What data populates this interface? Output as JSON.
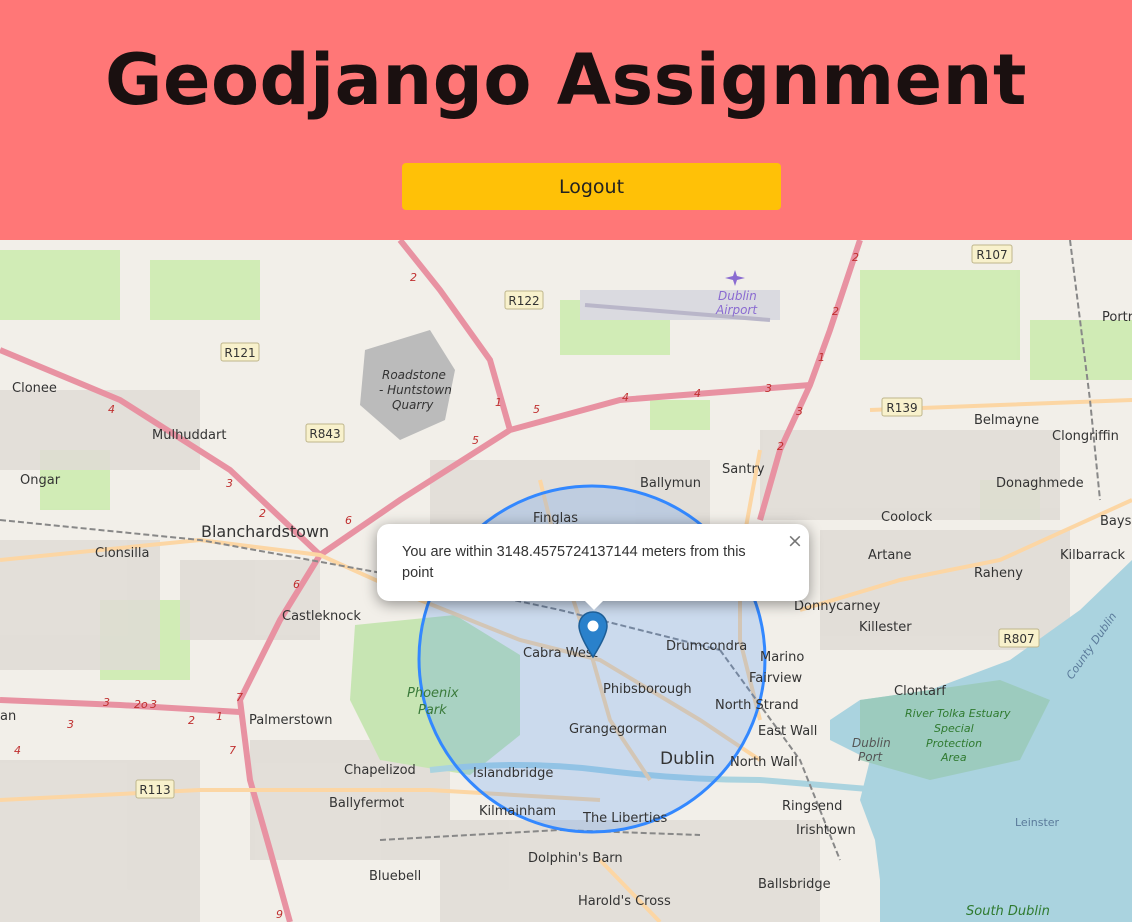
{
  "header": {
    "title": "Geodjango Assignment",
    "logout_label": "Logout",
    "bg_color": "#ff7777",
    "button_color": "#ffc107"
  },
  "map": {
    "circle_color": "#3388ff",
    "marker_icon": "map-marker-icon",
    "popup": {
      "text": "You are within 3148.4575724137144 meters from this point",
      "close_symbol": "×"
    },
    "places": {
      "clonee": "Clonee",
      "mulhuddart": "Mulhuddart",
      "ongar": "Ongar",
      "blanchardstown": "Blanchardstown",
      "clonsilla": "Clonsilla",
      "castleknock": "Castleknock",
      "palmerstown": "Palmerstown",
      "chapelizod": "Chapelizod",
      "ballyfermot": "Ballyfermot",
      "bluebell": "Bluebell",
      "lucan": "an",
      "roadstone_1": "Roadstone",
      "roadstone_2": "- Huntstown",
      "roadstone_3": "Quarry",
      "dublin_airport_1": "Dublin",
      "dublin_airport_2": "Airport",
      "ballymun": "Ballymun",
      "santry": "Santry",
      "finglas": "Finglas",
      "cabra_west": "Cabra West",
      "drumcondra": "Drumcondra",
      "phibsborough": "Phibsborough",
      "grangegorman": "Grangegorman",
      "dublin": "Dublin",
      "islandbridge": "Islandbridge",
      "kilmainham": "Kilmainham",
      "the_liberties": "The Liberties",
      "dolphins_barn": "Dolphin's Barn",
      "harolds_cross": "Harold's Cross",
      "phoenix_park_1": "Phoenix",
      "phoenix_park_2": "Park",
      "belmayne": "Belmayne",
      "clongriffin": "Clongriffin",
      "donaghmede": "Donaghmede",
      "coolock": "Coolock",
      "bayside": "Bays",
      "portmarnock": "Portr",
      "artane": "Artane",
      "kilbarrack": "Kilbarrack",
      "raheny": "Raheny",
      "donnycarney": "Donnycarney",
      "killester": "Killester",
      "marino": "Marino",
      "fairview": "Fairview",
      "clontarf": "Clontarf",
      "north_strand": "North Strand",
      "east_wall": "East Wall",
      "north_wall": "North Wall",
      "dublin_port_1": "Dublin",
      "dublin_port_2": "Port",
      "ringsend": "Ringsend",
      "irishtown": "Irishtown",
      "ballsbridge": "Ballsbridge",
      "tolka_1": "River Tolka Estuary",
      "tolka_2": "Special",
      "tolka_3": "Protection",
      "tolka_4": "Area",
      "leinster": "Leinster",
      "south_dublin": "South Dublin",
      "county_dublin": "County Dublin"
    },
    "roads": {
      "r122": "R122",
      "r121": "R121",
      "r843": "R843",
      "r107": "R107",
      "r139": "R139",
      "r807": "R807",
      "r113": "R113"
    },
    "road_numbers": {
      "n2a": "2",
      "n2b": "2",
      "n2c": "2",
      "n1a": "1",
      "n1b": "1",
      "n5a": "5",
      "n5b": "5",
      "n4a": "4",
      "n4b": "4",
      "n3a": "3",
      "n3b": "3",
      "n3c": "3",
      "n2d": "2",
      "n6a": "6",
      "n6b": "6",
      "n4c": "4",
      "n3d": "3",
      "n2e": "2",
      "n1c": "1",
      "n7a": "7",
      "n7b": "7",
      "n3e": "3",
      "n2oa": "2o",
      "n2f": "2",
      "n4d": "4",
      "n3f": "3",
      "n9": "9"
    }
  }
}
